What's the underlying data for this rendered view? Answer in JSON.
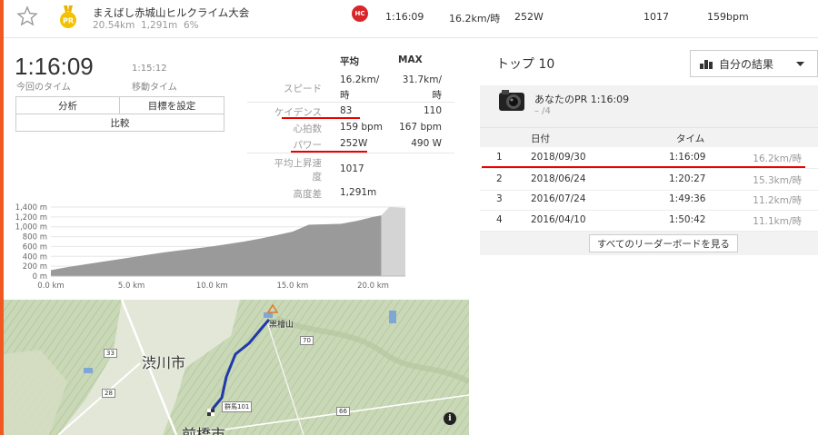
{
  "segment": {
    "name": "まえばし赤城山ヒルクライム大会",
    "distance": "20.54km",
    "elevation": "1,291m",
    "grade": "6%",
    "category_badge": "HC",
    "pr_badge": "PR",
    "time": "1:16:09",
    "speed": "16.2km/時",
    "power": "252W",
    "cadence": "1017",
    "heart_rate": "159bpm"
  },
  "summary": {
    "elapsed_time": "1:16:09",
    "elapsed_label": "今回のタイム",
    "moving_time": "1:15:12",
    "moving_label": "移動タイム"
  },
  "buttons": {
    "analysis": "分析",
    "set_goal": "目標を設定",
    "compare": "比較"
  },
  "stats": {
    "avg_header": "平均",
    "max_header": "MAX",
    "speed_label": "スピード",
    "speed_avg_line1": "16.2km/",
    "speed_avg_line2": "時",
    "speed_max_line1": "31.7km/",
    "speed_max_line2": "時",
    "cadence_label": "ケイデンス",
    "cadence_avg": "83",
    "cadence_max": "110",
    "hr_label": "心拍数",
    "hr_avg": "159 bpm",
    "hr_max": "167 bpm",
    "power_label": "パワー",
    "power_avg": "252W",
    "power_max": "490 W",
    "vam_label_line1": "平均上昇速",
    "vam_label_line2": "度",
    "vam_value": "1017",
    "elev_label": "高度差",
    "elev_value": "1,291m"
  },
  "chart_data": {
    "type": "area",
    "x_unit": "km",
    "y_unit": "m",
    "x": [
      0,
      1,
      2,
      3,
      4,
      5,
      6,
      7,
      8,
      9,
      10,
      11,
      12,
      13,
      14,
      15,
      16,
      17,
      18,
      19,
      20,
      20.5,
      21,
      22
    ],
    "y": [
      120,
      180,
      230,
      280,
      330,
      380,
      430,
      480,
      520,
      560,
      600,
      650,
      700,
      760,
      830,
      900,
      1040,
      1050,
      1060,
      1120,
      1200,
      1230,
      1400,
      1380
    ],
    "highlight_range": [
      0,
      20.5
    ],
    "xticks": [
      "0.0 km",
      "5.0 km",
      "10.0 km",
      "15.0 km",
      "20.0 km"
    ],
    "yticks": [
      "0 m",
      "200 m",
      "400 m",
      "600 m",
      "800 m",
      "1,000 m",
      "1,200 m",
      "1,400 m"
    ],
    "xlim": [
      0,
      22
    ],
    "ylim": [
      0,
      1400
    ]
  },
  "map": {
    "city_label": "渋川市",
    "peak_label": "黒檜山",
    "bottom_label": "前橋市",
    "road_101": "群馬101",
    "road_33": "33",
    "road_28": "28",
    "road_70": "70",
    "road_66": "66",
    "info_icon": "i"
  },
  "top10": {
    "title": "トップ 10",
    "results_dropdown": "自分の結果",
    "pr_title": "あなたのPR 1:16:09",
    "pr_rank": "– /4",
    "col_date": "日付",
    "col_time": "タイム",
    "rows": [
      {
        "rank": "1",
        "date": "2018/09/30",
        "time": "1:16:09",
        "speed": "16.2km/時"
      },
      {
        "rank": "2",
        "date": "2018/06/24",
        "time": "1:20:27",
        "speed": "15.3km/時"
      },
      {
        "rank": "3",
        "date": "2016/07/24",
        "time": "1:49:36",
        "speed": "11.2km/時"
      },
      {
        "rank": "4",
        "date": "2016/04/10",
        "time": "1:50:42",
        "speed": "11.1km/時"
      }
    ],
    "all_leaderboards": "すべてのリーダーボードを見る"
  }
}
